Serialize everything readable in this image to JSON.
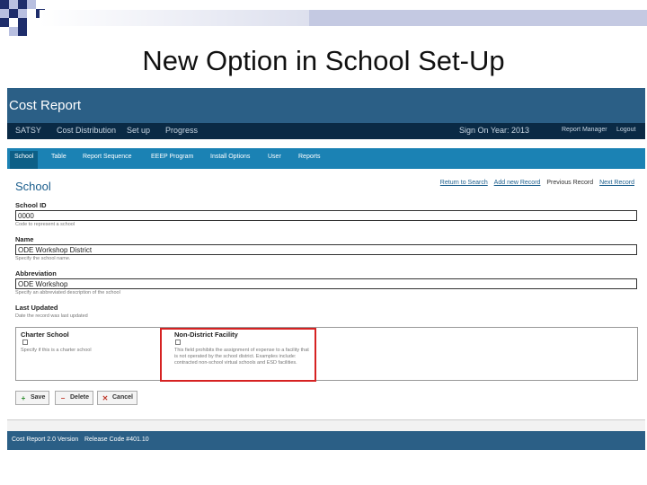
{
  "slide": {
    "title": "New Option in School Set-Up"
  },
  "app": {
    "title": "Cost Report",
    "topnav": {
      "left": [
        "SATSY",
        "Cost Distribution",
        "Set up",
        "Progress"
      ],
      "sign_on": "Sign On Year: 2013",
      "report_manager": "Report Manager",
      "logout": "Logout"
    },
    "tabs": [
      "School",
      "Table",
      "Report Sequence",
      "EEEP Program",
      "Install Options",
      "User",
      "Reports"
    ],
    "active_tab": "School",
    "page_heading": "School",
    "links": {
      "return": "Return to Search",
      "add": "Add new Record",
      "previous": "Previous Record",
      "next": "Next Record"
    },
    "fields": {
      "school_id": {
        "label": "School ID",
        "value": "0000",
        "hint": "Code to represent a school"
      },
      "name": {
        "label": "Name",
        "value": "ODE Workshop District",
        "hint": "Specify the school name."
      },
      "abbreviation": {
        "label": "Abbreviation",
        "value": "ODE Workshop",
        "hint": "Specify an abbreviated description of the school"
      },
      "last_updated": {
        "label": "Last Updated",
        "hint": "Date the record was last updated"
      }
    },
    "charter": {
      "label": "Charter School",
      "hint": "Specify if this is a charter school"
    },
    "nondistrict": {
      "label": "Non-District Facility",
      "hint": "This field prohibits the assignment of expense to a facility that is not operated by the school district. Examples include: contracted non-school virtual schools and ESD facilities."
    },
    "buttons": {
      "save": "Save",
      "delete": "Delete",
      "cancel": "Cancel"
    },
    "footer": {
      "version": "Cost Report 2.0 Version",
      "release": "Release Code #401.10"
    }
  }
}
